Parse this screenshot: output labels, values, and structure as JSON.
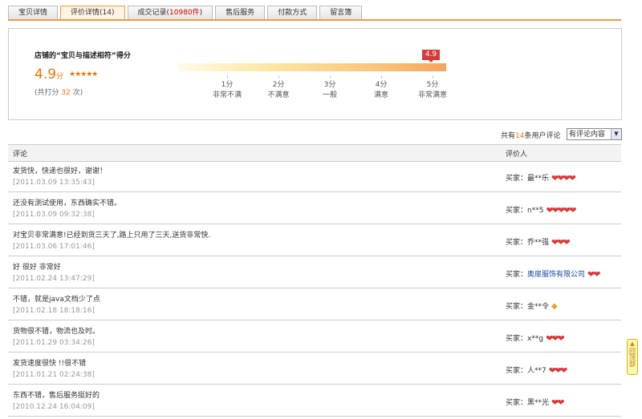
{
  "tabs": [
    {
      "label": "宝贝详情",
      "count": ""
    },
    {
      "label": "评价详情(14)",
      "count": ""
    },
    {
      "label": "成交记录(",
      "count": "10980件",
      "suffix": ")"
    },
    {
      "label": "售后服务",
      "count": ""
    },
    {
      "label": "付款方式",
      "count": ""
    },
    {
      "label": "留言簿",
      "count": ""
    }
  ],
  "score": {
    "title": "店铺的“宝贝与描述相符”得分",
    "value": "4.9",
    "unit": "分",
    "stars": "★★★★★",
    "total_prefix": "(共打分",
    "total_count": "32",
    "total_suffix": "次)",
    "marker": "4.9",
    "level": 0.98,
    "levels": [
      {
        "score": "1分",
        "label": "非常不满"
      },
      {
        "score": "2分",
        "label": "不满意"
      },
      {
        "score": "3分",
        "label": "一般"
      },
      {
        "score": "4分",
        "label": "满意"
      },
      {
        "score": "5分",
        "label": "非常满意"
      }
    ]
  },
  "summary": {
    "prefix": "共有",
    "count": "14",
    "suffix": "条用户评论"
  },
  "filter": {
    "selected": "有评论内容"
  },
  "table": {
    "headers": {
      "comment": "评论",
      "rater": "评价人"
    },
    "rows": [
      {
        "comment": "发货快，快递也很好，谢谢！",
        "date": "[2011.03.09 13:35:43]",
        "buyer_prefix": "买家：",
        "buyer": "最**乐",
        "badge": "heart",
        "badge_count": 4
      },
      {
        "comment": "还没有测试使用，东西确实不错。",
        "date": "[2011.03.09 09:32:38]",
        "buyer_prefix": "买家：",
        "buyer": "n**5",
        "badge": "heart",
        "badge_count": 5
      },
      {
        "comment": "对宝贝非常满意!已经到货三天了,路上只用了三天,送货非常快.",
        "date": "[2011.03.06 17:01:46]",
        "buyer_prefix": "买家：",
        "buyer": "乔**强",
        "badge": "heart",
        "badge_count": 3
      },
      {
        "comment": "好 很好 非常好",
        "date": "[2011.02.24 13:47:29]",
        "buyer_prefix": "买家：",
        "buyer": "奥扉服饰有限公司",
        "buyer_link": true,
        "badge": "heart",
        "badge_count": 2
      },
      {
        "comment": "不错，就是java文档少了点",
        "date": "[2011.02.18 18:18:16]",
        "buyer_prefix": "买家：",
        "buyer": "金**令",
        "badge": "gem",
        "badge_count": 1
      },
      {
        "comment": "货物很不错，物流也及时。",
        "date": "[2011.01.29 03:34:26]",
        "buyer_prefix": "买家：",
        "buyer": "x**g",
        "badge": "heart",
        "badge_count": 3
      },
      {
        "comment": "发货速度很快 !!很不错",
        "date": "[2011.01.21 02:24:38]",
        "buyer_prefix": "买家：",
        "buyer": "人**7",
        "badge": "heart",
        "badge_count": 3
      },
      {
        "comment": "东西不错，售后服务挺好的",
        "date": "[2010.12.24 16:04:09]",
        "buyer_prefix": "买家：",
        "buyer": "黑**光",
        "badge": "heart",
        "badge_count": 2
      }
    ]
  },
  "backtop": {
    "label": "回顶部"
  },
  "colors": {
    "accent": "#f07400",
    "heart": "#d63a3a",
    "link": "#1a4aa3"
  }
}
